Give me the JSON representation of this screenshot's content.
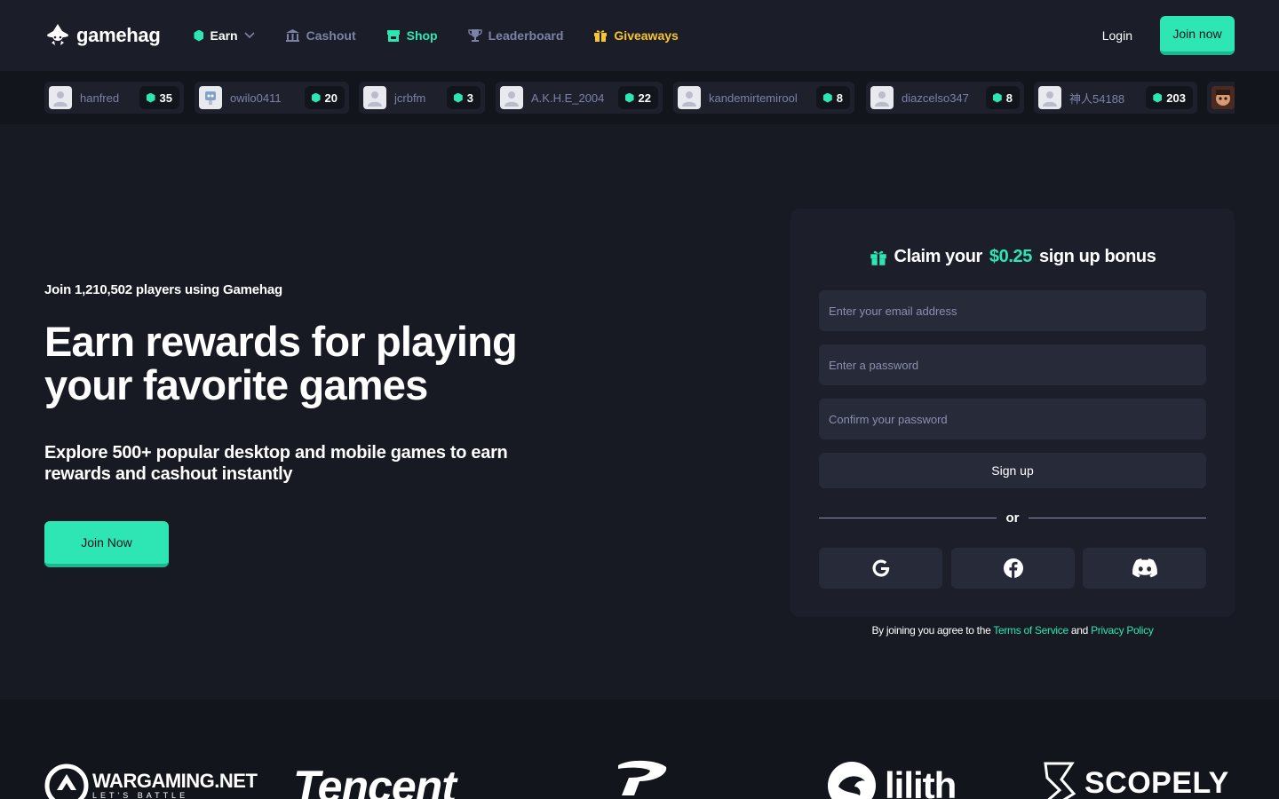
{
  "header": {
    "logo_text": "gamehag",
    "nav": [
      {
        "label": "Earn",
        "icon": "gem-icon"
      },
      {
        "label": "Cashout",
        "icon": "bank-icon"
      },
      {
        "label": "Shop",
        "icon": "shop-icon"
      },
      {
        "label": "Leaderboard",
        "icon": "trophy-icon"
      },
      {
        "label": "Giveaways",
        "icon": "gift-icon"
      }
    ],
    "login": "Login",
    "join": "Join now"
  },
  "ticker": [
    {
      "name": "hanfred",
      "gems": "35"
    },
    {
      "name": "owilo0411",
      "gems": "20"
    },
    {
      "name": "jcrbfm",
      "gems": "3"
    },
    {
      "name": "A.K.H.E_2004",
      "gems": "22"
    },
    {
      "name": "kandemirtemirool",
      "gems": "8"
    },
    {
      "name": "diazcelso347",
      "gems": "8"
    },
    {
      "name": "神人54188",
      "gems": "203"
    }
  ],
  "hero": {
    "players": "Join 1,210,502 players using Gamehag",
    "title": "Earn rewards for playing your favorite games",
    "description": "Explore 500+ popular desktop and mobile games to earn rewards and cashout instantly",
    "cta": "Join Now"
  },
  "signup": {
    "title_pre": "Claim your",
    "amount": "$0.25",
    "title_post": "sign up bonus",
    "email_placeholder": "Enter your email address",
    "password_placeholder": "Enter a password",
    "confirm_placeholder": "Confirm your password",
    "submit": "Sign up",
    "or": "or",
    "terms_pre": "By joining you agree to the",
    "terms_link": "Terms of Service",
    "terms_and": "and",
    "privacy_link": "Privacy Policy"
  },
  "partners": {
    "wargaming": "WARGAMING.NET",
    "wargaming_tag": "LET'S BATTLE",
    "tencent": "Tencent",
    "lilith": "lilith",
    "scopely": "SCOPELY"
  },
  "colors": {
    "accent": "#2de6b4",
    "gold": "#f7c62c",
    "bg": "#171923",
    "card": "#1c1f2a"
  }
}
